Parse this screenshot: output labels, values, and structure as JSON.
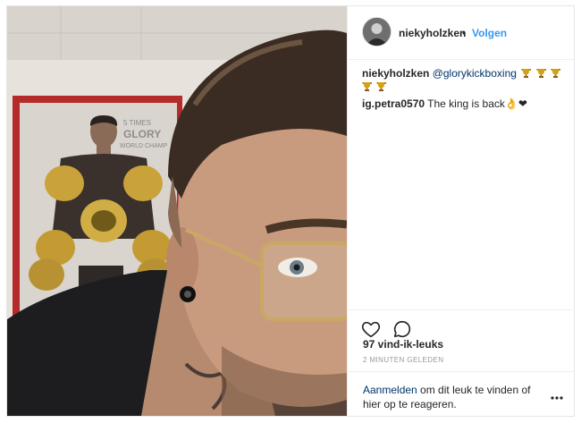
{
  "post": {
    "author": "niekyholzken",
    "separator": "•",
    "follow_label": "Volgen",
    "caption": {
      "user": "niekyholzken",
      "mention": "@glorykickboxing",
      "trophy_icon": "trophy-icon",
      "trophy_count": 5
    },
    "comments": [
      {
        "user": "ig.petra0570",
        "text": "The king is back👌❤"
      }
    ],
    "likes": "97 vind-ik-leuks",
    "timestamp": "2 MINUTEN GELEDEN",
    "login_prompt": {
      "link": "Aanmelden",
      "text": " om dit leuk te vinden of hier op te reageren."
    },
    "photo": {
      "poster_text_line1": "5 TIMES",
      "poster_text_line2": "GLORY",
      "poster_text_line3": "WORLD CHAMP"
    }
  },
  "icons": [
    "heart-icon",
    "comment-icon",
    "more-options-icon",
    "trophy-icon"
  ],
  "colors": {
    "link": "#3897f0",
    "mention": "#003569",
    "muted": "#999999",
    "border": "#efefef"
  }
}
